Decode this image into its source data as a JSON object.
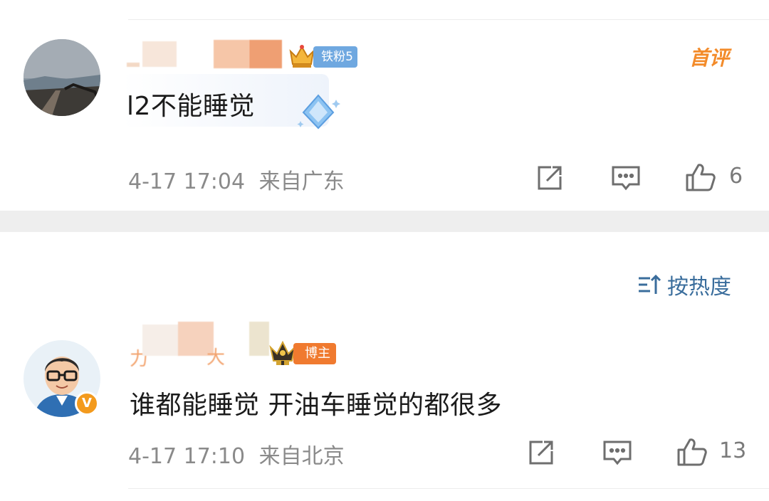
{
  "comments": [
    {
      "username": "l",
      "badge": "铁粉5",
      "tag": "首评",
      "text": "l2不能睡觉",
      "time": "4-17 17:04",
      "location": "来自广东",
      "likes": "6"
    },
    {
      "username": "万 大",
      "badge": "博主",
      "text": "谁都能睡觉 开油车睡觉的都很多",
      "time": "4-17 17:10",
      "location": "来自北京",
      "likes": "13"
    }
  ],
  "sort_label": "按热度",
  "icons": [
    "share-icon",
    "comment-icon",
    "like-icon",
    "sort-icon",
    "crown-icon",
    "verified-icon",
    "diamond-sticker-icon"
  ],
  "colors": {
    "link": "#3a6d9c",
    "orange": "#f07a2f",
    "blue_badge": "#6fa8e0",
    "meta": "#8a8a8a"
  }
}
